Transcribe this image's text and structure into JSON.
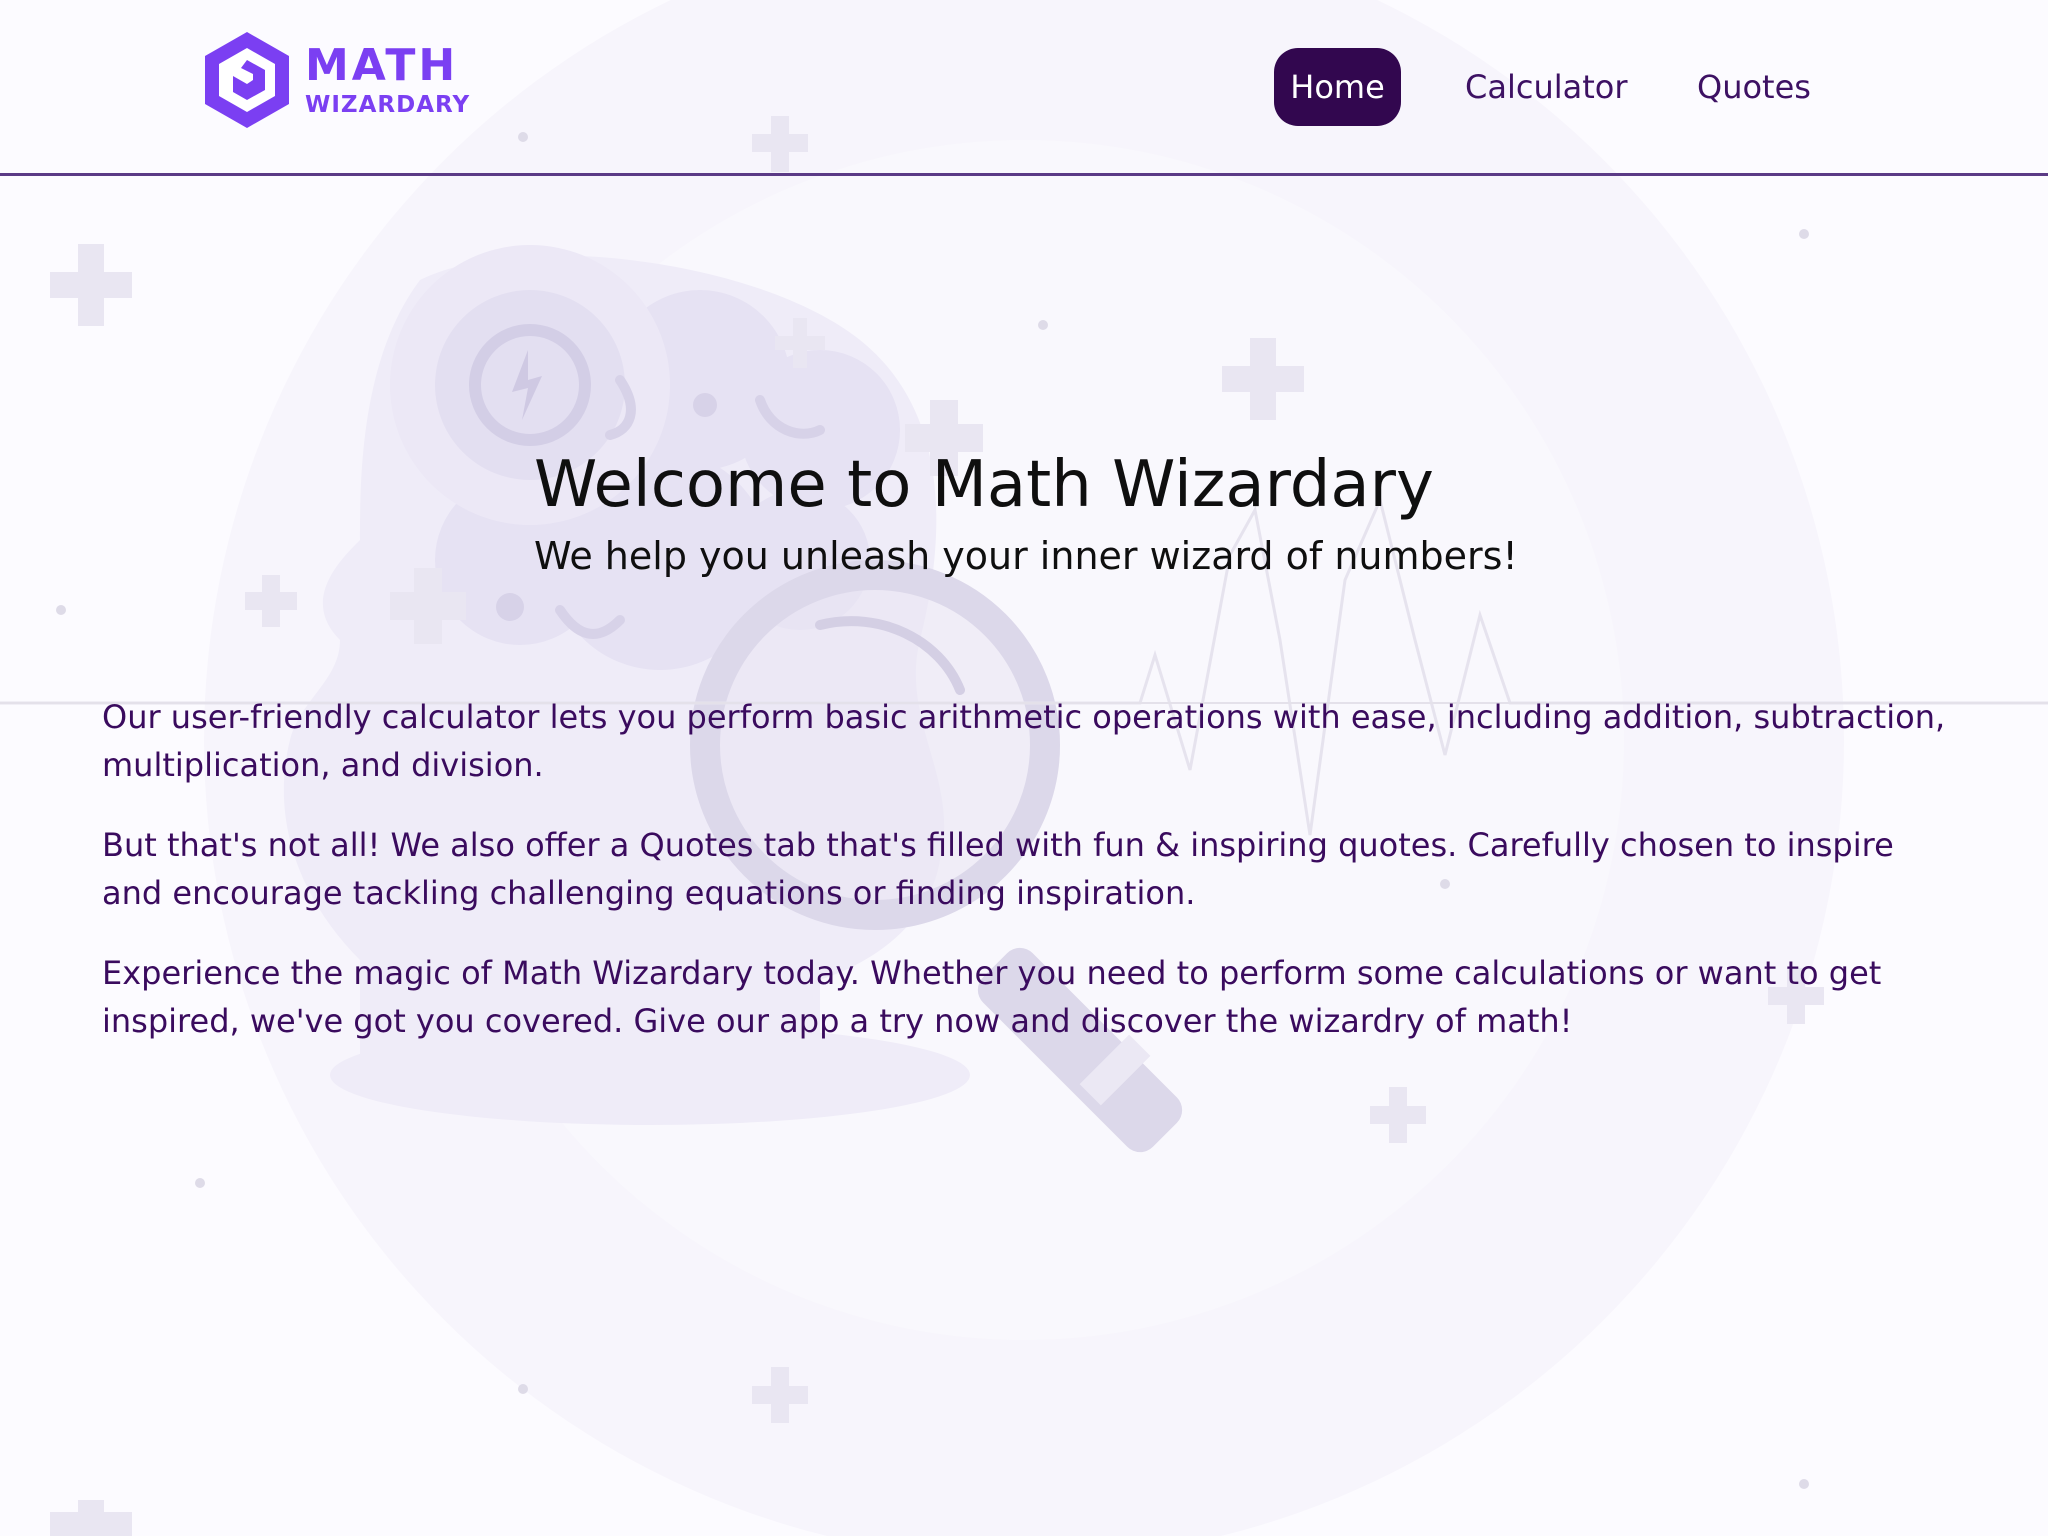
{
  "brand": {
    "line1": "MATH",
    "line2": "WIZARDARY",
    "accent_color": "#7b3ff2",
    "dark_color": "#32074f"
  },
  "nav": {
    "items": [
      {
        "label": "Home",
        "active": true
      },
      {
        "label": "Calculator",
        "active": false
      },
      {
        "label": "Quotes",
        "active": false
      }
    ]
  },
  "hero": {
    "title": "Welcome to Math Wizardary",
    "subtitle": "We help you unleash your inner wizard of numbers!"
  },
  "content": {
    "paragraphs": [
      "Our user-friendly calculator lets you perform basic arithmetic operations with ease, including addition, subtraction, multiplication, and division.",
      "But that's not all! We also offer a Quotes tab that's filled with fun & inspiring quotes. Carefully chosen to inspire and encourage tackling challenging equations or finding inspiration.",
      "Experience the magic of Math Wizardary today. Whether you need to perform some calculations or want to get inspired, we've got you covered. Give our app a try now and discover the wizardry of math!"
    ]
  }
}
